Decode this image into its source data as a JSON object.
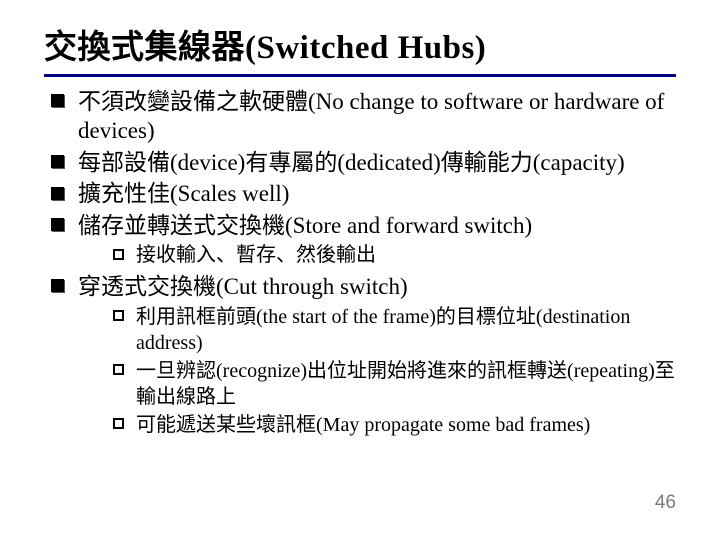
{
  "title": "交換式集線器(Switched Hubs)",
  "bullets": {
    "b0": "不須改變設備之軟硬體(No change to software or hardware of devices)",
    "b1": "每部設備(device)有專屬的(dedicated)傳輸能力(capacity)",
    "b2": "擴充性佳(Scales well)",
    "b3": "儲存並轉送式交換機(Store and forward switch)",
    "b3_sub": {
      "s0": "接收輸入、暫存、然後輸出"
    },
    "b4": "穿透式交換機(Cut through switch)",
    "b4_sub": {
      "s0": "利用訊框前頭(the start of the frame)的目標位址(destination address)",
      "s1": "一旦辨認(recognize)出位址開始將進來的訊框轉送(repeating)至輸出線路上",
      "s2": "可能遞送某些壞訊框(May propagate some bad frames)"
    }
  },
  "page_number": "46"
}
